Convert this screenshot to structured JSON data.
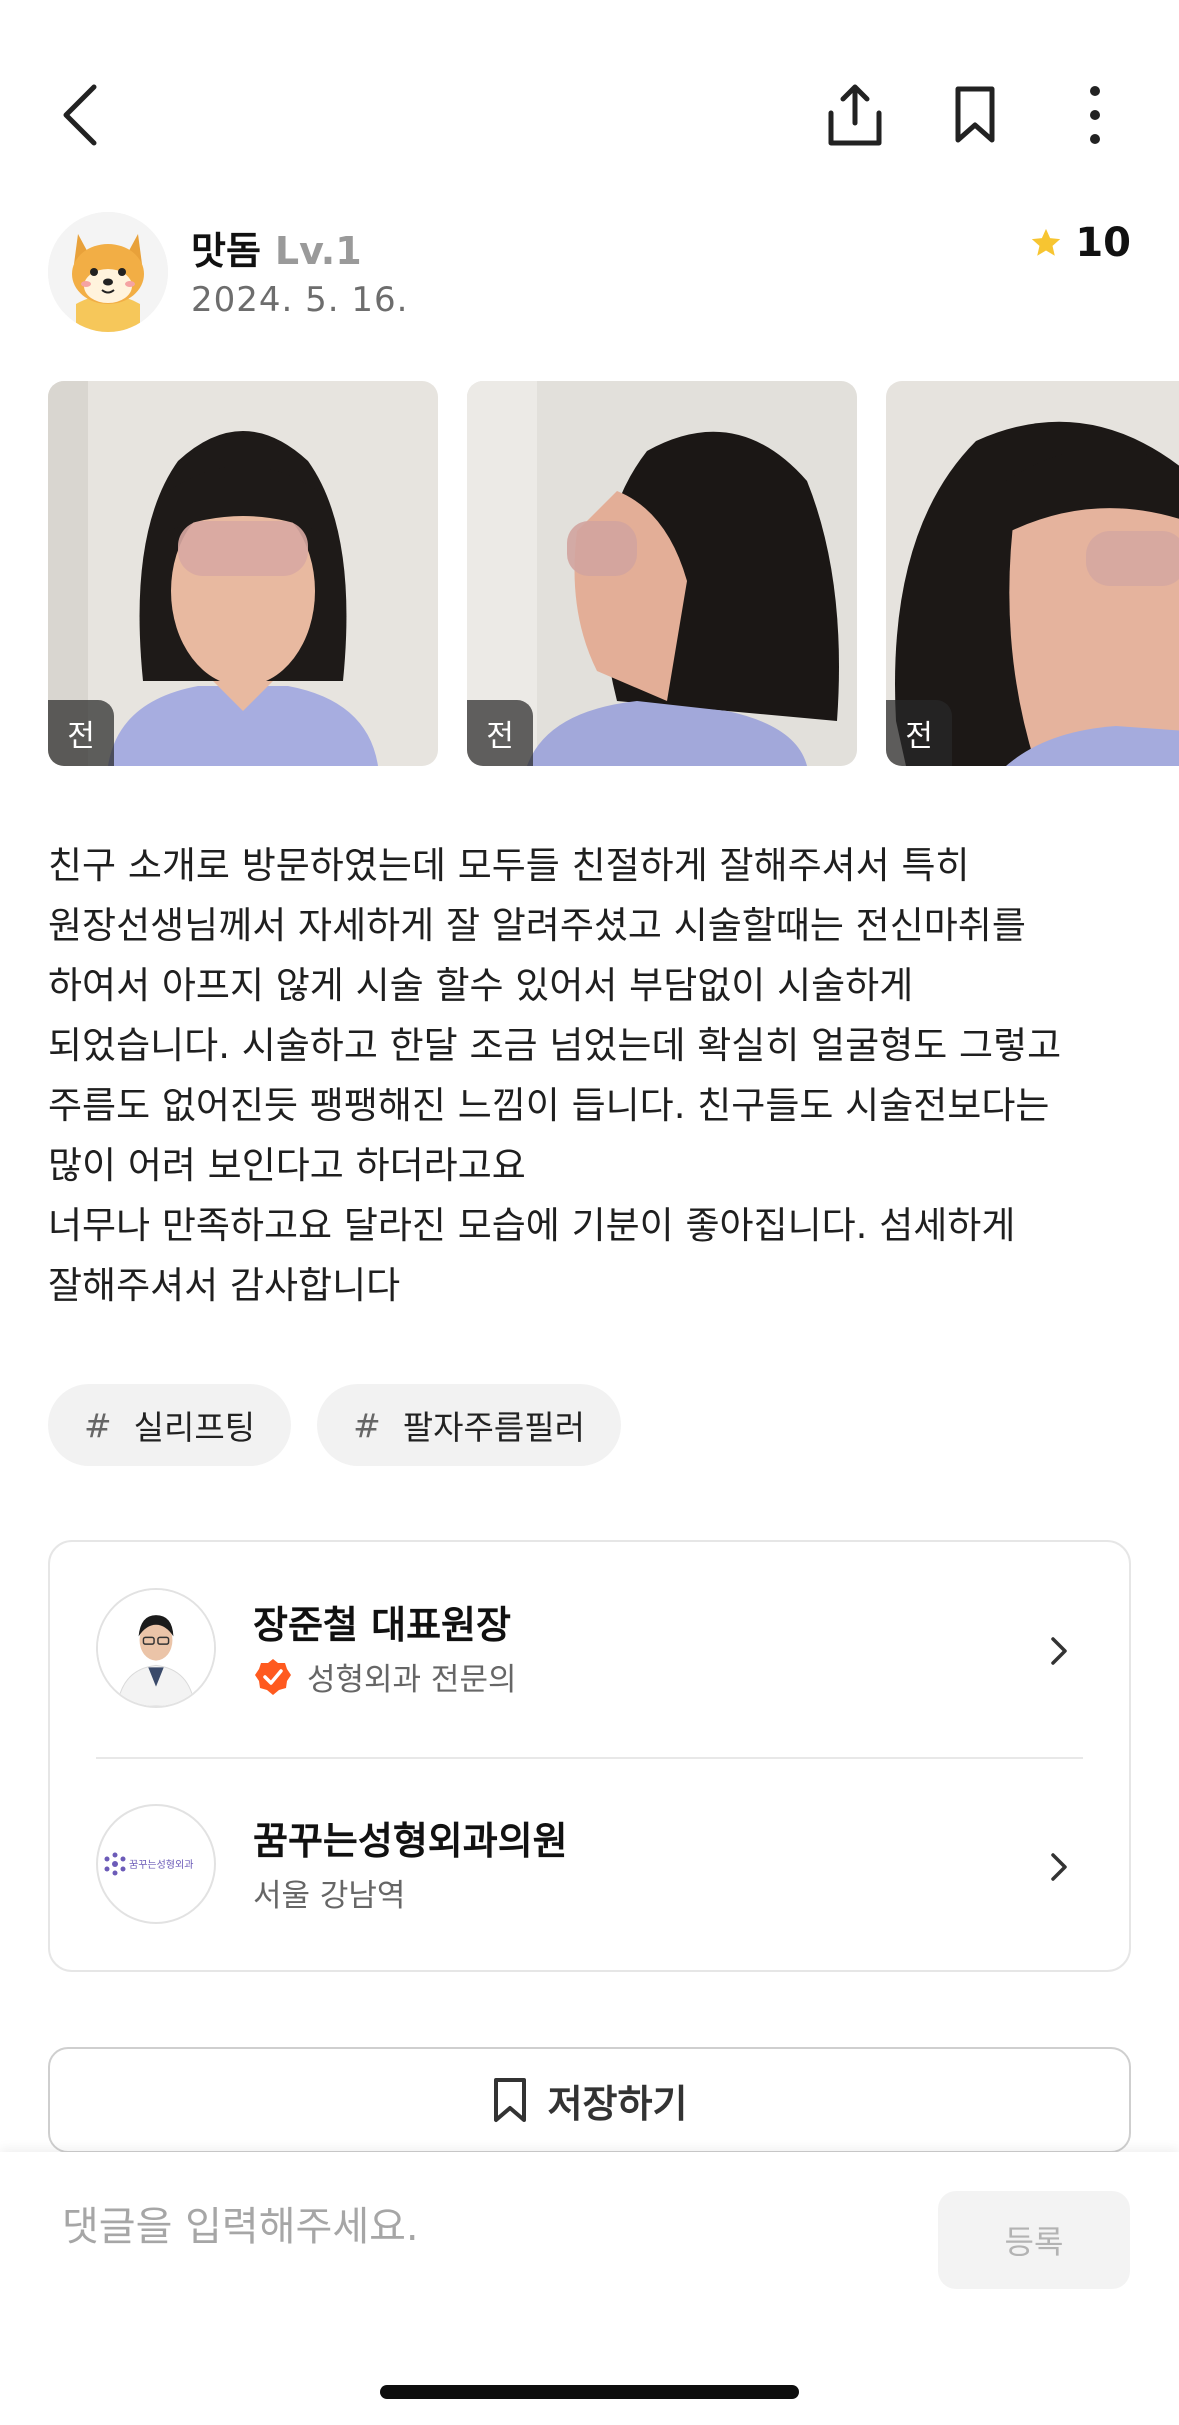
{
  "header": {
    "back_icon": "chevron-left-icon",
    "share_icon": "share-icon",
    "bookmark_icon": "bookmark-icon",
    "more_icon": "more-vertical-icon"
  },
  "author": {
    "name": "맛돔",
    "level": "Lv.1",
    "date": "2024. 5. 16.",
    "avatar_icon": "shiba-dog-avatar",
    "rating": "10",
    "rating_icon": "star-icon",
    "star_color": "#F7C531"
  },
  "photos": [
    {
      "badge": "전",
      "view": "front"
    },
    {
      "badge": "전",
      "view": "side-right"
    },
    {
      "badge": "전",
      "view": "three-quarter"
    }
  ],
  "review": {
    "body": "친구 소개로 방문하였는데 모두들 친절하게 잘해주셔서 특히\n원장선생님께서 자세하게 잘 알려주셨고 시술할때는 전신마취를\n하여서 아프지 않게 시술 할수 있어서 부담없이 시술하게\n되었습니다. 시술하고 한달 조금 넘었는데 확실히 얼굴형도 그렇고\n주름도 없어진듯 팽팽해진 느낌이 듭니다. 친구들도 시술전보다는\n많이 어려 보인다고 하더라고요\n너무나 만족하고요 달라진 모습에 기분이 좋아집니다. 섬세하게\n잘해주셔서 감사합니다"
  },
  "tags": [
    {
      "hash": "#",
      "label": "실리프팅"
    },
    {
      "hash": "#",
      "label": "팔자주름필러"
    }
  ],
  "doctor_card": {
    "doctor_name": "장준철 대표원장",
    "doctor_specialty": "성형외과 전문의",
    "verified_color": "#FF5A1F",
    "clinic_name": "꿈꾸는성형외과의원",
    "clinic_location": "서울 강남역",
    "clinic_logo_text": "꿈꾸는성형외과"
  },
  "save_button": {
    "label": "저장하기"
  },
  "comment": {
    "placeholder": "댓글을 입력해주세요.",
    "submit_label": "등록"
  }
}
